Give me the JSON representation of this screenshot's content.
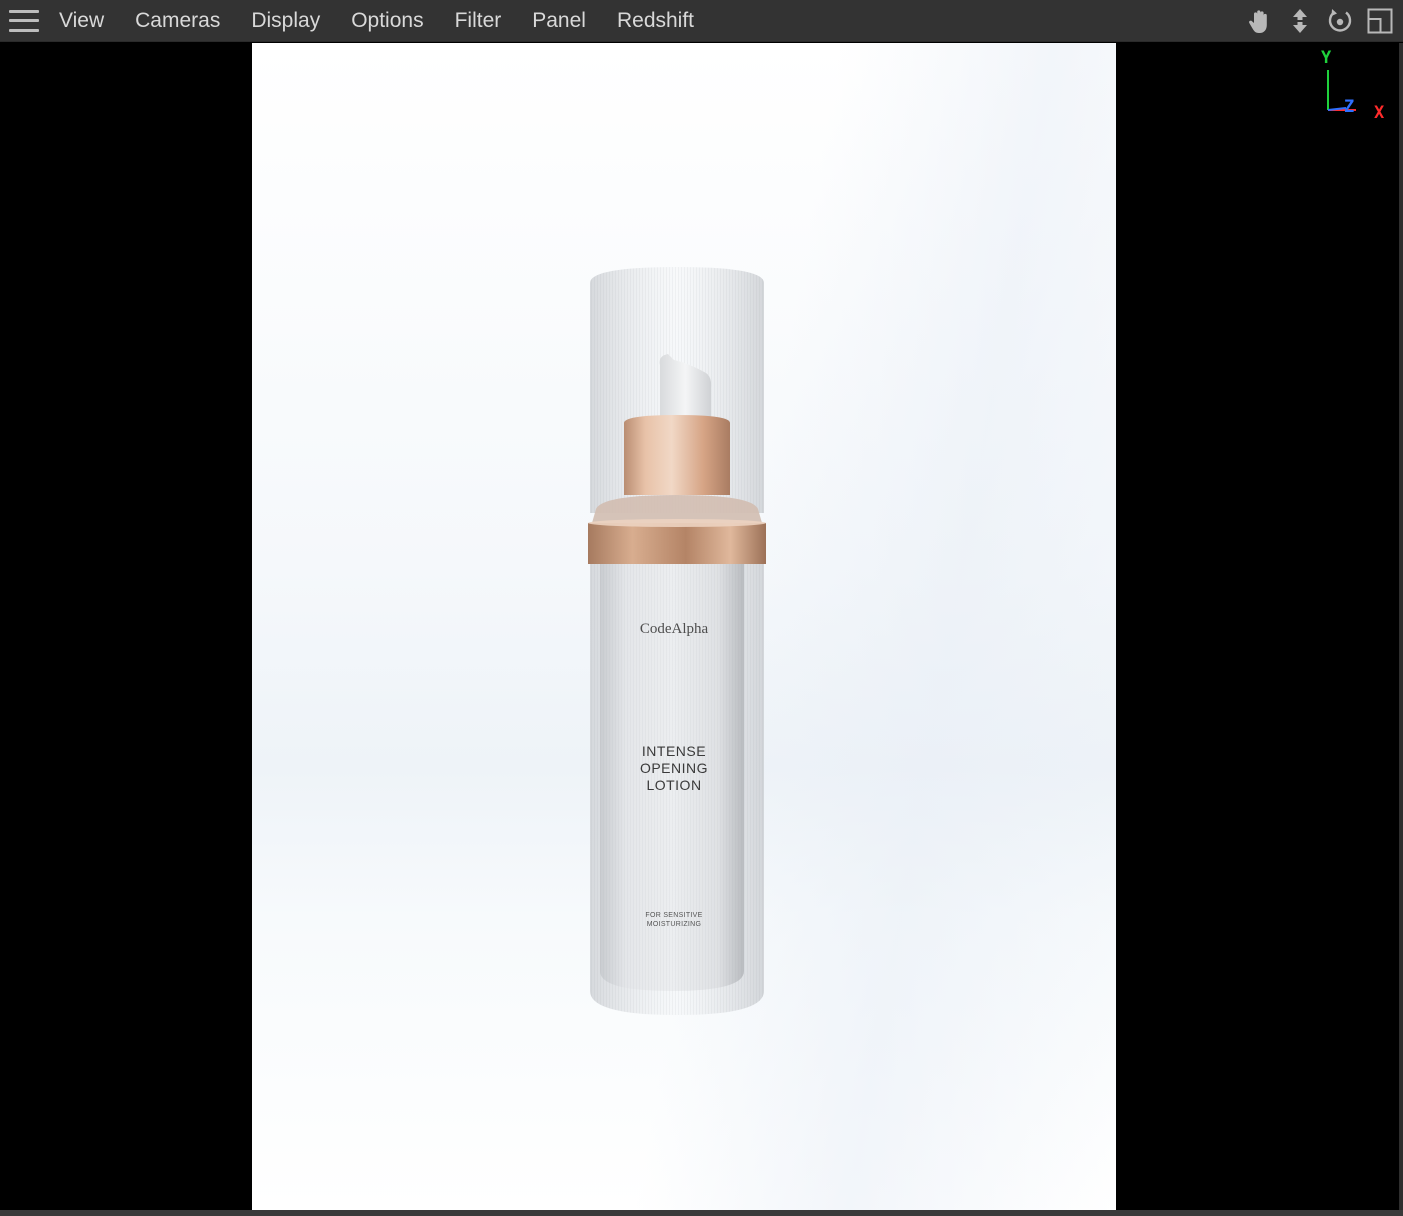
{
  "menubar": {
    "items": [
      "View",
      "Cameras",
      "Display",
      "Options",
      "Filter",
      "Panel",
      "Redshift"
    ]
  },
  "nav_icons": [
    "hand-pan-icon",
    "move-arrows-icon",
    "orbit-rotate-icon",
    "maximize-panel-icon"
  ],
  "axis": {
    "y": "Y",
    "z": "Z",
    "x": "X",
    "colors": {
      "y": "#1fd13c",
      "z": "#2f6fff",
      "x": "#ff2b2b"
    }
  },
  "bottle_label": {
    "brand": "CodeAlpha",
    "product_lines": [
      "INTENSE",
      "OPENING",
      "LOTION"
    ],
    "fine_print": [
      "FOR SENSITIVE",
      "MOISTURIZING"
    ]
  },
  "colors": {
    "menubar_bg": "#333333",
    "menu_text": "#d9d9d9",
    "accent_rose_gold": "#d9a98a"
  }
}
